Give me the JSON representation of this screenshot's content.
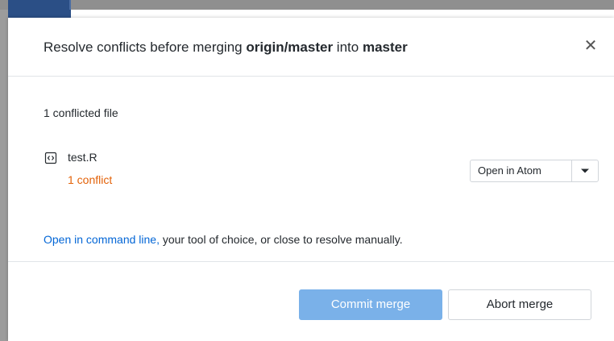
{
  "dialog": {
    "title_prefix": "Resolve conflicts before merging",
    "source_branch": "origin/master",
    "title_middle": "into",
    "target_branch": "master",
    "close_glyph": "✕"
  },
  "conflicts": {
    "summary": "1 conflicted file",
    "files": [
      {
        "icon": "file-code-icon",
        "name": "test.R",
        "conflict_count": "1 conflict",
        "open_with_label": "Open in Atom",
        "open_with_menu_icon": "caret-down-icon"
      }
    ]
  },
  "hint": {
    "link_text": "Open in command line,",
    "rest_text": " your tool of choice, or close to resolve manually."
  },
  "footer": {
    "commit_label": "Commit merge",
    "abort_label": "Abort merge"
  },
  "colors": {
    "conflict_orange": "#e36209",
    "link_blue": "#0366d6",
    "commit_disabled_blue": "#7ab1e9"
  }
}
